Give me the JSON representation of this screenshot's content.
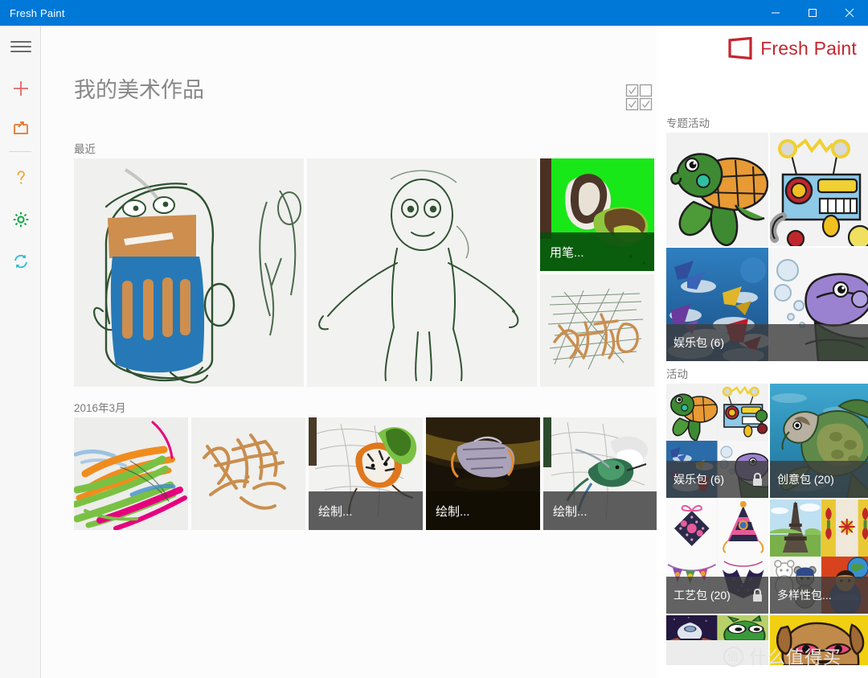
{
  "window": {
    "title": "Fresh Paint",
    "accent_color": "#0078d7",
    "controls": [
      {
        "name": "minimize",
        "glyph": "minimize-icon"
      },
      {
        "name": "maximize",
        "glyph": "maximize-icon"
      },
      {
        "name": "close",
        "glyph": "close-icon"
      }
    ]
  },
  "brand": {
    "text": "Fresh Paint",
    "color": "#c4262e"
  },
  "rail": {
    "items": [
      {
        "name": "menu-icon",
        "color": "#6b6b6b"
      },
      {
        "name": "new-icon",
        "color": "#e06666"
      },
      {
        "name": "open-icon",
        "color": "#e2752a"
      },
      {
        "name": "help-icon",
        "color": "#f0a830"
      },
      {
        "name": "settings-icon",
        "color": "#0ba83c"
      },
      {
        "name": "sync-icon",
        "color": "#2bb8d8"
      }
    ]
  },
  "main": {
    "page_title": "我的美术作品",
    "select_mode_label": "select-mode",
    "sections": [
      {
        "label": "最近",
        "items": [
          {
            "caption": "",
            "caption_style": "none",
            "size": "big"
          },
          {
            "caption": "",
            "caption_style": "none",
            "size": "big"
          },
          {
            "caption": "用笔...",
            "caption_style": "green",
            "size": "small"
          },
          {
            "caption": "",
            "caption_style": "none",
            "size": "small"
          }
        ]
      },
      {
        "label": "2016年3月",
        "items": [
          {
            "caption": "",
            "caption_style": "none",
            "size": "medium"
          },
          {
            "caption": "",
            "caption_style": "none",
            "size": "medium"
          },
          {
            "caption": "绘制...",
            "caption_style": "gray",
            "size": "medium"
          },
          {
            "caption": "绘制...",
            "caption_style": "dark",
            "size": "medium"
          },
          {
            "caption": "绘制...",
            "caption_style": "gray",
            "size": "medium"
          }
        ]
      }
    ]
  },
  "right": {
    "featured": {
      "label": "专题活动",
      "caption": "娱乐包 (6)",
      "locked": false
    },
    "activity": {
      "label": "活动",
      "packs": [
        {
          "caption": "娱乐包 (6)",
          "locked": true
        },
        {
          "caption": "创意包 (20)",
          "locked": false
        },
        {
          "caption": "工艺包 (20)",
          "locked": true
        },
        {
          "caption": "多样性包...",
          "locked": false
        },
        {
          "caption": "",
          "locked": false
        },
        {
          "caption": "",
          "locked": false
        }
      ]
    }
  },
  "watermark": {
    "mark": "值",
    "text": "什么值得买"
  }
}
